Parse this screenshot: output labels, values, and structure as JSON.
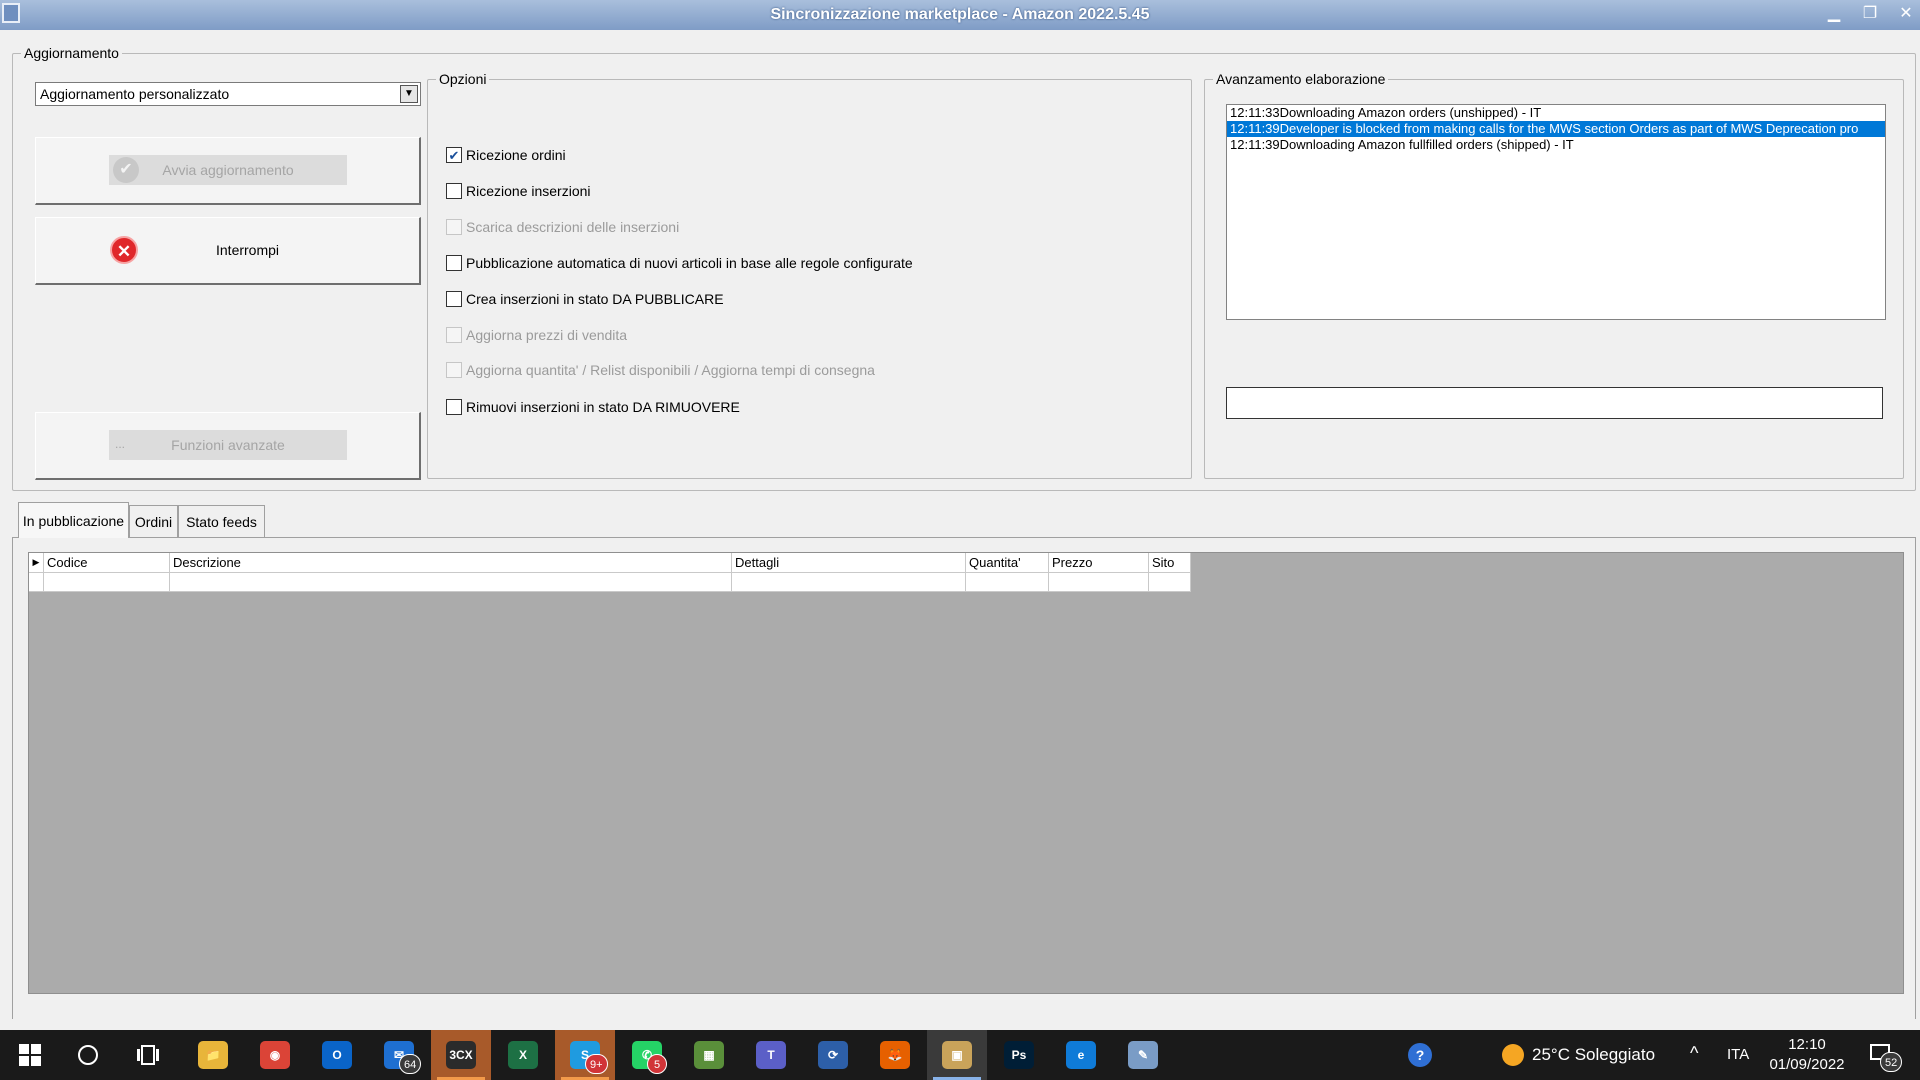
{
  "window": {
    "title": "Sincronizzazione marketplace - Amazon 2022.5.45",
    "minimize": "▁",
    "maximize": "❐",
    "close": "✕"
  },
  "aggiornamento": {
    "legend": "Aggiornamento",
    "mode_selected": "Aggiornamento personalizzato",
    "start_button": "Avvia aggiornamento",
    "stop_button": "Interrompi",
    "advanced_button": "Funzioni avanzate",
    "advanced_prefix": "..."
  },
  "opzioni": {
    "legend": "Opzioni",
    "items": [
      {
        "label": "Ricezione ordini",
        "checked": true,
        "enabled": true
      },
      {
        "label": "Ricezione inserzioni",
        "checked": false,
        "enabled": true
      },
      {
        "label": "Scarica descrizioni delle inserzioni",
        "checked": false,
        "enabled": false
      },
      {
        "label": "Pubblicazione automatica di nuovi articoli in base alle regole configurate",
        "checked": false,
        "enabled": true
      },
      {
        "label": "Crea inserzioni in stato DA PUBBLICARE",
        "checked": false,
        "enabled": true
      },
      {
        "label": "Aggiorna prezzi di vendita",
        "checked": false,
        "enabled": false
      },
      {
        "label": "Aggiorna quantita' / Relist disponibili / Aggiorna tempi di consegna",
        "checked": false,
        "enabled": false
      },
      {
        "label": "Rimuovi inserzioni in stato DA RIMUOVERE",
        "checked": false,
        "enabled": true
      }
    ]
  },
  "avanzamento": {
    "legend": "Avanzamento elaborazione",
    "log": [
      {
        "time": "12:11:33",
        "text": "Downloading Amazon orders (unshipped) - IT",
        "selected": false
      },
      {
        "time": "12:11:39",
        "text": "Developer is blocked from making calls for the MWS section Orders as part of MWS Deprecation pro",
        "selected": true
      },
      {
        "time": "12:11:39",
        "text": "Downloading Amazon fullfilled orders (shipped) - IT",
        "selected": false
      }
    ]
  },
  "tabs": [
    {
      "label": "In pubblicazione",
      "active": true
    },
    {
      "label": "Ordini",
      "active": false
    },
    {
      "label": "Stato feeds",
      "active": false
    }
  ],
  "grid": {
    "columns": [
      "Codice",
      "Descrizione",
      "Dettagli",
      "Quantita'",
      "Prezzo",
      "Sito"
    ],
    "row_indicator": "▶"
  },
  "taskbar": {
    "apps": [
      {
        "name": "file-explorer",
        "label": "📁",
        "color": "#e8b53a"
      },
      {
        "name": "chrome",
        "label": "◉",
        "color": "#db4437"
      },
      {
        "name": "outlook",
        "label": "O",
        "color": "#0a64c8"
      },
      {
        "name": "mail",
        "label": "✉",
        "color": "#1e6fd1",
        "badge": "64",
        "badge_dark": true
      },
      {
        "name": "3cx",
        "label": "3CX",
        "color": "#2b2b2b",
        "orange": true
      },
      {
        "name": "excel",
        "label": "X",
        "color": "#1d7044"
      },
      {
        "name": "skype",
        "label": "S",
        "color": "#1f9be0",
        "badge": "9+",
        "orange": true
      },
      {
        "name": "whatsapp",
        "label": "✆",
        "color": "#25d366",
        "badge": "5"
      },
      {
        "name": "chart-app",
        "label": "▦",
        "color": "#5a8f3a"
      },
      {
        "name": "teams",
        "label": "T",
        "color": "#5b5fc7"
      },
      {
        "name": "sync-app",
        "label": "⟳",
        "color": "#2d5fa8"
      },
      {
        "name": "firefox",
        "label": "🦊",
        "color": "#e66000"
      },
      {
        "name": "this-app",
        "label": "▣",
        "color": "#c9a35a",
        "active": true
      },
      {
        "name": "photoshop",
        "label": "Ps",
        "color": "#001e36"
      },
      {
        "name": "edge",
        "label": "e",
        "color": "#0f7bd8"
      },
      {
        "name": "paint",
        "label": "✎",
        "color": "#7a9cc6"
      }
    ],
    "weather": "25°C Soleggiato",
    "language": "ITA",
    "time": "12:10",
    "date": "01/09/2022",
    "notifications": "52"
  }
}
